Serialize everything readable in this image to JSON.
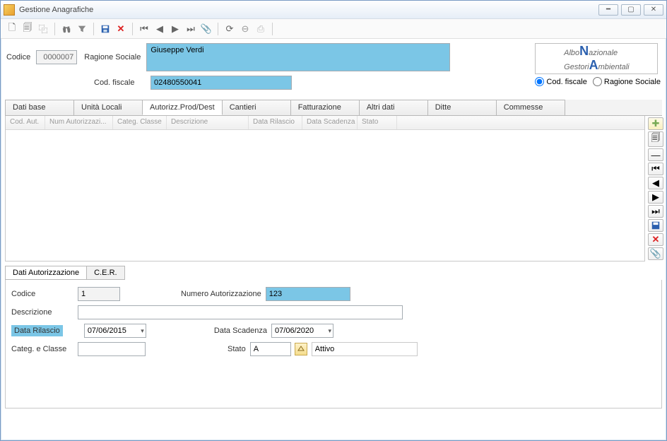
{
  "window": {
    "title": "Gestione Anagrafiche"
  },
  "header": {
    "codice_label": "Codice",
    "codice_value": "0000007",
    "ragione_label": "Ragione Sociale",
    "ragione_value": "Giuseppe Verdi",
    "cf_label": "Cod. fiscale",
    "cf_value": "02480550041"
  },
  "logo": {
    "line1a": "Albo",
    "line1b": "N",
    "line1c": "azionale",
    "line2a": "Gestori",
    "line2b": "A",
    "line2c": "mbientali"
  },
  "radios": {
    "cf": "Cod. fiscale",
    "rs": "Ragione Sociale"
  },
  "tabs": [
    "Dati base",
    "Unità Locali",
    "Autorizz.Prod/Dest",
    "Cantieri",
    "Fatturazione",
    "Altri dati",
    "Ditte",
    "Commesse"
  ],
  "grid_cols": [
    {
      "label": "Cod. Aut.",
      "w": 56
    },
    {
      "label": "Num Autorizzazi...",
      "w": 96
    },
    {
      "label": "Categ. Classe",
      "w": 76
    },
    {
      "label": "Descrizione",
      "w": 116
    },
    {
      "label": "Data Rilascio",
      "w": 76
    },
    {
      "label": "Data Scadenza",
      "w": 78
    },
    {
      "label": "Stato",
      "w": 56
    }
  ],
  "subtabs": [
    "Dati Autorizzazione",
    "C.E.R."
  ],
  "form": {
    "codice_label": "Codice",
    "codice_value": "1",
    "numaut_label": "Numero Autorizzazione",
    "numaut_value": "123",
    "descr_label": "Descrizione",
    "descr_value": "",
    "datarilascio_label": "Data Rilascio",
    "datarilascio_value": "07/06/2015",
    "datascadenza_label": "Data Scadenza",
    "datascadenza_value": "07/06/2020",
    "categ_label": "Categ.  e Classe",
    "categ_value": "",
    "stato_label": "Stato",
    "stato_code": "A",
    "stato_text": "Attivo"
  }
}
